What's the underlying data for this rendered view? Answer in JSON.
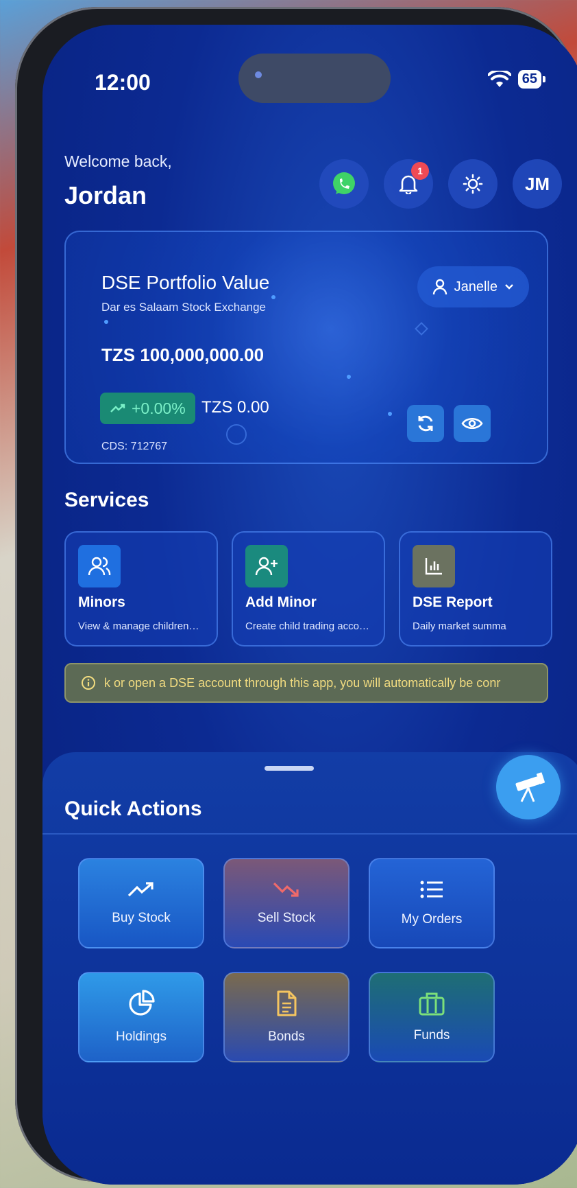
{
  "status_bar": {
    "time": "12:00",
    "battery": "65"
  },
  "header": {
    "welcome": "Welcome back,",
    "name": "Jordan",
    "notification_count": "1",
    "avatar_initials": "JM"
  },
  "portfolio": {
    "title": "DSE Portfolio Value",
    "subtitle": "Dar es Salaam Stock Exchange",
    "value": "TZS 100,000,000.00",
    "change_pct": "+0.00%",
    "change_amt": "TZS 0.00",
    "cds": "CDS: 712767",
    "account": "Janelle"
  },
  "services": {
    "title": "Services",
    "items": [
      {
        "name": "Minors",
        "desc": "View & manage children…",
        "icon": "users-icon",
        "color": "#1f6fe0"
      },
      {
        "name": "Add Minor",
        "desc": "Create child trading acco…",
        "icon": "user-plus-icon",
        "color": "#1a8a7e"
      },
      {
        "name": "DSE Report",
        "desc": "Daily market summa",
        "icon": "bar-chart-icon",
        "color": "#6b7260"
      }
    ]
  },
  "banner": {
    "text": "k or open a DSE account through this app, you will automatically be conr"
  },
  "quick_actions": {
    "title": "Quick Actions",
    "items": [
      {
        "label": "Buy Stock",
        "icon": "trending-up-icon"
      },
      {
        "label": "Sell Stock",
        "icon": "trending-down-icon"
      },
      {
        "label": "My Orders",
        "icon": "list-icon"
      },
      {
        "label": "Holdings",
        "icon": "pie-chart-icon"
      },
      {
        "label": "Bonds",
        "icon": "document-icon"
      },
      {
        "label": "Funds",
        "icon": "briefcase-icon"
      }
    ]
  },
  "colors": {
    "background": "#0c2a92",
    "accent": "#3b9ef0",
    "positive": "#7bf0c8",
    "badge": "#ef4a55",
    "warning_text": "#f2dc80"
  }
}
